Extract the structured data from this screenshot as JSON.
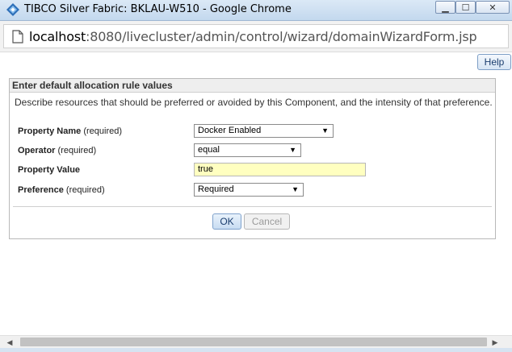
{
  "window": {
    "title": "TIBCO Silver Fabric: BKLAU-W510 - Google Chrome",
    "minimize_glyph": "▁",
    "maximize_glyph": "☐",
    "close_glyph": "✕"
  },
  "address": {
    "host": "localhost",
    "rest": ":8080/livecluster/admin/control/wizard/domainWizardForm.jsp"
  },
  "help_label": "Help",
  "panel": {
    "title": "Enter default allocation rule values",
    "description": "Describe resources that should be preferred or avoided by this Component, and the intensity of that preference."
  },
  "form": {
    "property_name": {
      "label": "Property Name",
      "suffix": " (required)",
      "value": "Docker Enabled"
    },
    "operator": {
      "label": "Operator",
      "suffix": " (required)",
      "value": "equal"
    },
    "property_value": {
      "label": "Property Value",
      "value": "true"
    },
    "preference": {
      "label": "Preference",
      "suffix": " (required)",
      "value": "Required"
    }
  },
  "buttons": {
    "ok": "OK",
    "cancel": "Cancel"
  },
  "scrollbar": {
    "left_glyph": "◀",
    "right_glyph": "▶"
  },
  "icons": {
    "app": "tibco-diamond-icon",
    "page": "page-icon",
    "dropdown": "▼"
  },
  "colors": {
    "title_bar": "#c3d8ee",
    "input_highlight": "#ffffc0",
    "ok_button": "#c7dcf2"
  }
}
